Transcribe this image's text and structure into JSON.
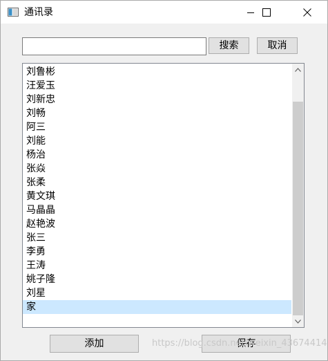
{
  "window": {
    "title": "通讯录"
  },
  "search": {
    "value": "",
    "placeholder": ""
  },
  "buttons": {
    "search": "搜索",
    "cancel": "取消",
    "add": "添加",
    "save": "保存"
  },
  "contacts": [
    {
      "name": "刘鲁彬"
    },
    {
      "name": "汪爱玉"
    },
    {
      "name": "刘新忠"
    },
    {
      "name": "刘畅"
    },
    {
      "name": "阿三"
    },
    {
      "name": "刘能"
    },
    {
      "name": "杨治"
    },
    {
      "name": "张焱"
    },
    {
      "name": "张柔"
    },
    {
      "name": "黄文琪"
    },
    {
      "name": "马晶晶"
    },
    {
      "name": "赵艳波"
    },
    {
      "name": "张三"
    },
    {
      "name": "李勇"
    },
    {
      "name": "王涛"
    },
    {
      "name": "姚子隆"
    },
    {
      "name": "刘星"
    },
    {
      "name": "家",
      "selected": true
    }
  ],
  "watermark": "https://blog.csdn.net/weixin_43674414",
  "colors": {
    "selection": "#cce8ff",
    "button_face": "#e1e1e1",
    "window_bg": "#f0f0f0"
  }
}
